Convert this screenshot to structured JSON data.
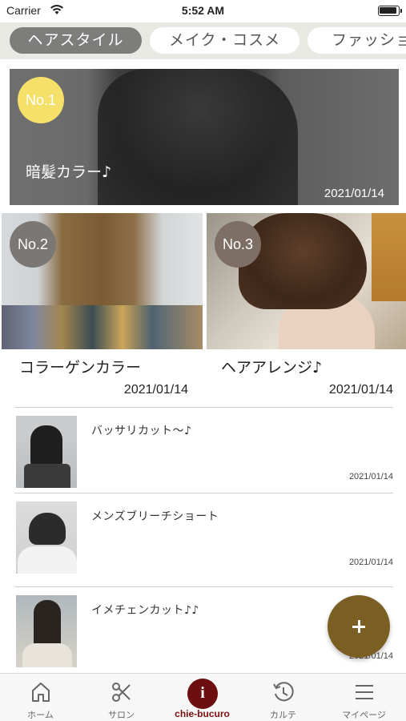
{
  "status_bar": {
    "carrier": "Carrier",
    "time": "5:52 AM"
  },
  "category_tabs": [
    {
      "label": "ヘアスタイル",
      "active": true
    },
    {
      "label": "メイク・コスメ",
      "active": false
    },
    {
      "label": "ファッショ",
      "active": false
    }
  ],
  "feature": {
    "rank": "No.1",
    "title": "暗髪カラー♪",
    "date": "2021/01/14"
  },
  "grid": [
    {
      "rank": "No.2",
      "title": "コラーゲンカラー",
      "date": "2021/01/14"
    },
    {
      "rank": "No.3",
      "title": "ヘアアレンジ♪",
      "date": "2021/01/14"
    }
  ],
  "list": [
    {
      "title": "バッサリカット～♪",
      "date": "2021/01/14"
    },
    {
      "title": "メンズブリーチショート",
      "date": "2021/01/14"
    },
    {
      "title": "イメチェンカット♪♪",
      "date": "2021/01/14"
    }
  ],
  "fab": {
    "icon": "plus-icon"
  },
  "tab_bar": [
    {
      "label": "ホーム",
      "icon": "home-icon"
    },
    {
      "label": "サロン",
      "icon": "scissors-icon"
    },
    {
      "label": "chie-bucuro",
      "icon": "info-icon",
      "active": true
    },
    {
      "label": "カルテ",
      "icon": "history-icon"
    },
    {
      "label": "マイページ",
      "icon": "menu-icon"
    }
  ],
  "colors": {
    "rank1": "#f5e06a",
    "rank2": "#7b7775",
    "rank3": "#7e6f66",
    "accent": "#6d0e10",
    "fab": "#7a5e23",
    "tab_active": "#7d7d7b",
    "tab_strip": "#e8e9e3"
  }
}
